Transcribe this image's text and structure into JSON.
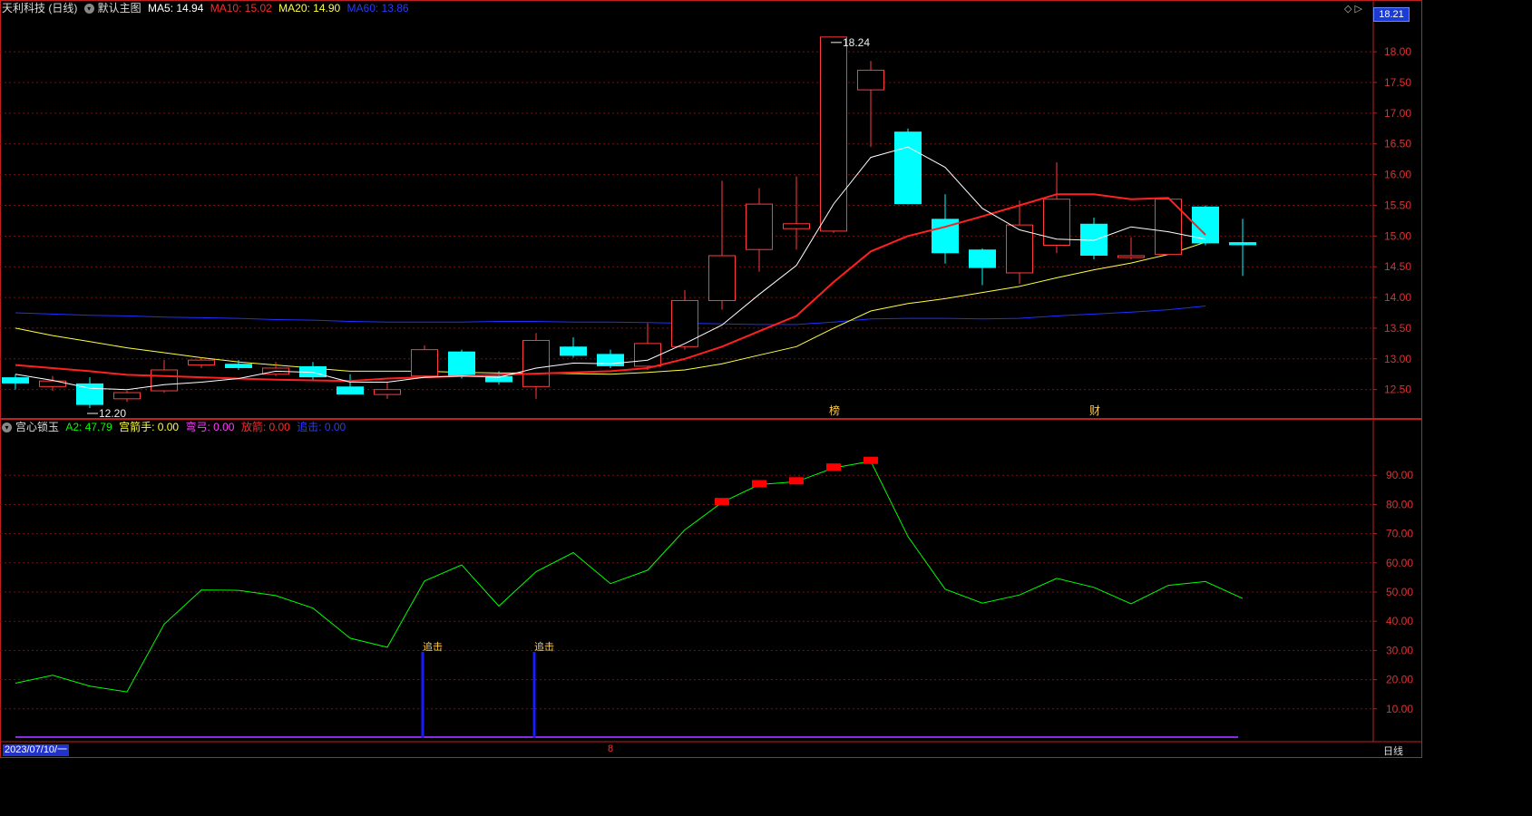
{
  "header": {
    "stock_title": "天利科技 (日线)",
    "main_chart_label": "默认主图",
    "ma5": "MA5: 14.94",
    "ma10": "MA10: 15.02",
    "ma20": "MA20: 14.90",
    "ma60": "MA60: 13.86",
    "current_price_tag": "18.21"
  },
  "indicator_header": {
    "name": "宫心锁玉",
    "a2": "A2: 47.79",
    "gongjianshou": "宫箭手: 0.00",
    "wanggong": "弯弓: 0.00",
    "fangjian": "放箭: 0.00",
    "zhuiji": "追击: 0.00"
  },
  "footer": {
    "date": "2023/07/10/一",
    "period": "日线",
    "marker": "8"
  },
  "colors": {
    "up": "#ff3b3b",
    "down": "#00ffff",
    "ma5": "#ffffff",
    "ma10": "#ff2020",
    "ma20": "#ffff40",
    "ma60": "#2030ff",
    "a2": "#00ff00",
    "signal_block": "#ff0000",
    "zhuiji": "#1a1aff",
    "grid": "#7a1010",
    "axis": "#c02020"
  },
  "chart_data": [
    {
      "type": "candlestick",
      "title": "天利科技 (日线)",
      "ylim": [
        12.2,
        18.4
      ],
      "y_ticks": [
        "18.00",
        "17.50",
        "17.00",
        "16.50",
        "16.00",
        "15.50",
        "15.00",
        "14.50",
        "14.00",
        "13.50",
        "13.00",
        "12.50"
      ],
      "candles": [
        {
          "o": 12.7,
          "h": 12.75,
          "l": 12.5,
          "c": 12.6
        },
        {
          "o": 12.55,
          "h": 12.72,
          "l": 12.48,
          "c": 12.64
        },
        {
          "o": 12.6,
          "h": 12.7,
          "l": 12.2,
          "c": 12.25
        },
        {
          "o": 12.35,
          "h": 12.48,
          "l": 12.3,
          "c": 12.45
        },
        {
          "o": 12.48,
          "h": 12.98,
          "l": 12.45,
          "c": 12.82
        },
        {
          "o": 12.9,
          "h": 13.02,
          "l": 12.85,
          "c": 12.98
        },
        {
          "o": 12.92,
          "h": 12.98,
          "l": 12.82,
          "c": 12.85
        },
        {
          "o": 12.75,
          "h": 12.95,
          "l": 12.72,
          "c": 12.85
        },
        {
          "o": 12.88,
          "h": 12.95,
          "l": 12.65,
          "c": 12.7
        },
        {
          "o": 12.55,
          "h": 12.75,
          "l": 12.42,
          "c": 12.42
        },
        {
          "o": 12.42,
          "h": 12.62,
          "l": 12.35,
          "c": 12.5
        },
        {
          "o": 12.72,
          "h": 13.22,
          "l": 12.7,
          "c": 13.15
        },
        {
          "o": 13.12,
          "h": 13.15,
          "l": 12.68,
          "c": 12.72
        },
        {
          "o": 12.72,
          "h": 12.8,
          "l": 12.58,
          "c": 12.62
        },
        {
          "o": 12.55,
          "h": 13.42,
          "l": 12.35,
          "c": 13.3
        },
        {
          "o": 13.2,
          "h": 13.35,
          "l": 13.02,
          "c": 13.05
        },
        {
          "o": 13.08,
          "h": 13.15,
          "l": 12.85,
          "c": 12.88
        },
        {
          "o": 12.88,
          "h": 13.58,
          "l": 12.82,
          "c": 13.25
        },
        {
          "o": 13.2,
          "h": 14.12,
          "l": 13.15,
          "c": 13.95
        },
        {
          "o": 13.95,
          "h": 15.9,
          "l": 13.8,
          "c": 14.68
        },
        {
          "o": 14.78,
          "h": 15.78,
          "l": 14.42,
          "c": 15.52
        },
        {
          "o": 15.12,
          "h": 15.97,
          "l": 14.78,
          "c": 15.2
        },
        {
          "o": 15.08,
          "h": 18.24,
          "l": 15.05,
          "c": 18.24
        },
        {
          "o": 17.38,
          "h": 17.85,
          "l": 16.45,
          "c": 17.7
        },
        {
          "o": 16.7,
          "h": 16.75,
          "l": 15.52,
          "c": 15.52
        },
        {
          "o": 15.28,
          "h": 15.68,
          "l": 14.55,
          "c": 14.72
        },
        {
          "o": 14.78,
          "h": 14.8,
          "l": 14.2,
          "c": 14.48
        },
        {
          "o": 14.4,
          "h": 15.58,
          "l": 14.22,
          "c": 15.18
        },
        {
          "o": 14.85,
          "h": 16.2,
          "l": 14.72,
          "c": 15.6
        },
        {
          "o": 15.2,
          "h": 15.3,
          "l": 14.62,
          "c": 14.68
        },
        {
          "o": 14.68,
          "h": 14.98,
          "l": 14.62,
          "c": 14.68
        },
        {
          "o": 14.7,
          "h": 15.62,
          "l": 14.7,
          "c": 15.6
        },
        {
          "o": 15.48,
          "h": 15.5,
          "l": 14.85,
          "c": 14.88
        },
        {
          "o": 14.9,
          "h": 15.28,
          "l": 14.35,
          "c": 14.85
        }
      ],
      "ma5": [
        12.75,
        12.65,
        12.52,
        12.5,
        12.58,
        12.62,
        12.68,
        12.8,
        12.78,
        12.62,
        12.62,
        12.7,
        12.72,
        12.7,
        12.85,
        12.93,
        12.92,
        12.98,
        13.25,
        13.55,
        14.05,
        14.52,
        15.52,
        16.28,
        16.45,
        16.12,
        15.45,
        15.1,
        14.95,
        14.93,
        15.15,
        15.07,
        14.95
      ],
      "ma10": [
        12.9,
        12.85,
        12.8,
        12.74,
        12.72,
        12.7,
        12.68,
        12.66,
        12.65,
        12.64,
        12.68,
        12.7,
        12.72,
        12.74,
        12.76,
        12.78,
        12.8,
        12.85,
        13.0,
        13.2,
        13.45,
        13.7,
        14.25,
        14.75,
        15.0,
        15.15,
        15.32,
        15.5,
        15.68,
        15.68,
        15.6,
        15.62,
        15.02
      ],
      "ma20": [
        13.5,
        13.38,
        13.28,
        13.18,
        13.1,
        13.02,
        12.95,
        12.9,
        12.85,
        12.8,
        12.8,
        12.8,
        12.78,
        12.77,
        12.77,
        12.76,
        12.75,
        12.78,
        12.82,
        12.92,
        13.06,
        13.2,
        13.5,
        13.78,
        13.9,
        13.98,
        14.08,
        14.18,
        14.32,
        14.45,
        14.56,
        14.7,
        14.9
      ],
      "ma60": [
        13.75,
        13.73,
        13.71,
        13.7,
        13.68,
        13.67,
        13.66,
        13.64,
        13.63,
        13.61,
        13.6,
        13.6,
        13.6,
        13.61,
        13.61,
        13.6,
        13.6,
        13.59,
        13.58,
        13.57,
        13.56,
        13.56,
        13.6,
        13.65,
        13.66,
        13.66,
        13.65,
        13.66,
        13.7,
        13.73,
        13.76,
        13.8,
        13.86
      ],
      "annotations": [
        {
          "index": 22,
          "label": "18.24",
          "price": 18.24
        },
        {
          "index": 2,
          "label": "12.20",
          "price": 12.2
        },
        {
          "index": 22,
          "label": "榜",
          "at": "bottom"
        },
        {
          "index": 29,
          "label": "财",
          "at": "bottom"
        }
      ]
    },
    {
      "type": "line",
      "title": "宫心锁玉",
      "ylim": [
        0,
        100
      ],
      "y_ticks": [
        "90.00",
        "80.00",
        "70.00",
        "60.00",
        "50.00",
        "40.00",
        "30.00",
        "20.00",
        "10.00"
      ],
      "series": [
        {
          "name": "A2",
          "values": [
            18.8,
            21.5,
            17.8,
            15.8,
            39,
            50.7,
            50.6,
            48.8,
            44.5,
            34.2,
            31.1,
            53.8,
            59.3,
            45.2,
            57,
            63.5,
            52.9,
            57.5,
            71.3,
            80.7,
            86.8,
            87.8,
            92.5,
            94.8,
            69,
            51,
            46.2,
            49,
            54.7,
            51.6,
            46,
            52.3,
            53.6,
            47.8
          ]
        }
      ],
      "signal_blocks": [
        19,
        20,
        21,
        22,
        23
      ],
      "zhuiji_bars": [
        {
          "index": 11,
          "value": 29.5,
          "label": "追击"
        },
        {
          "index": 14,
          "value": 29.5,
          "label": "追击"
        }
      ]
    }
  ]
}
